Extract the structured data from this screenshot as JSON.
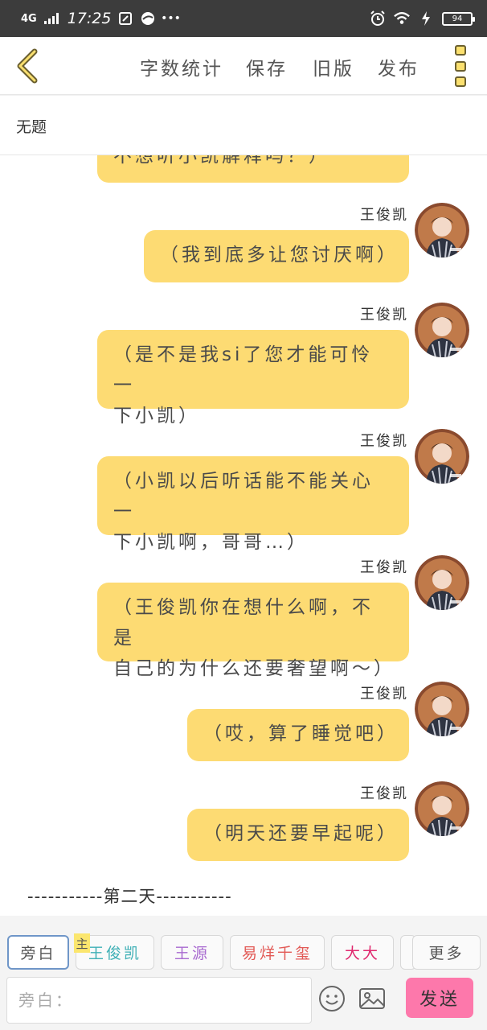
{
  "status_bar": {
    "network": "4G",
    "time": "17:25",
    "battery": "94",
    "icons": [
      "signal-icon",
      "sim-icon",
      "browser-icon",
      "more-dots-icon",
      "alarm-icon",
      "wifi-icon",
      "charging-icon",
      "battery-icon"
    ]
  },
  "toolbar": {
    "word_count": "字数统计",
    "save": "保存",
    "old_version": "旧版",
    "publish": "发布"
  },
  "doc_title": "无题",
  "messages": [
    {
      "sender": "",
      "text": "不想听小凯解释吗？）"
    },
    {
      "sender": "王俊凯",
      "text": "（我到底多让您讨厌啊）"
    },
    {
      "sender": "王俊凯",
      "line1": "（是不是我si了您才能可怜一",
      "line2": "下小凯）"
    },
    {
      "sender": "王俊凯",
      "line1": "（小凯以后听话能不能关心一",
      "line2": "下小凯啊，哥哥…）"
    },
    {
      "sender": "王俊凯",
      "line1": "（王俊凯你在想什么啊，不是",
      "line2": "自己的为什么还要奢望啊～）"
    },
    {
      "sender": "王俊凯",
      "text": "（哎，算了睡觉吧）"
    },
    {
      "sender": "王俊凯",
      "text": "（明天还要早起呢）"
    }
  ],
  "day_divider": "-----------第二天-----------",
  "roles": {
    "narration": "旁白",
    "main_badge": "主",
    "wang_junkai": "王俊凯",
    "wang_yuan": "王源",
    "yiyang_qianxi": "易烊千玺",
    "dada": "大大",
    "more": "更多"
  },
  "input": {
    "placeholder": "旁白：",
    "value": ""
  },
  "send_label": "发送",
  "colors": {
    "bubble": "#fddb73",
    "send_button": "#fd78ab",
    "wang_junkai": "#3fb0b6",
    "wang_yuan": "#a86ad0",
    "yiyang_qianxi": "#e25a56",
    "dada": "#e0286e"
  }
}
